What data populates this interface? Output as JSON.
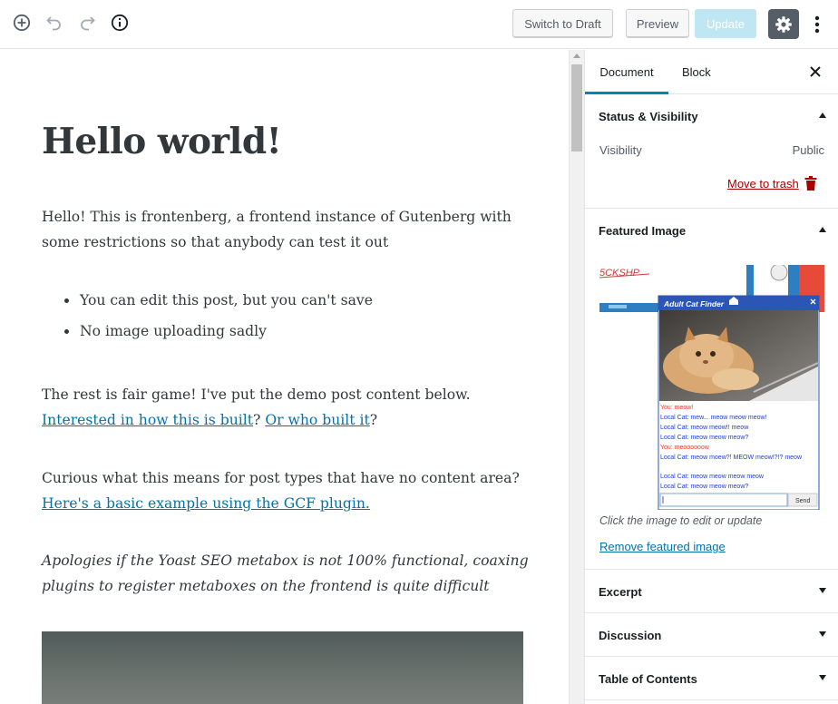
{
  "toolbar": {
    "icons": [
      "add-block-icon",
      "undo-icon",
      "redo-icon",
      "info-icon"
    ],
    "switch_to_draft_label": "Switch to Draft",
    "preview_label": "Preview",
    "update_label": "Update",
    "settings_icon": "gear-icon",
    "more_icon": "more-vertical-icon"
  },
  "post": {
    "title": "Hello world!",
    "intro": "Hello! This is frontenberg, a frontend instance of Gutenberg with some restrictions so that anybody can test it out",
    "bullets": [
      "You can edit this post, but you can't save",
      "No image uploading sadly"
    ],
    "fair_game_text": "The rest is fair game! I've put the demo post content below. ",
    "link_built": "Interested in how this is built",
    "question_sep": "? ",
    "link_who": "Or who built it",
    "question_end": "?",
    "curious_text": "Curious what this means for post types that have no content area? ",
    "link_gcf": "Here's a basic example using the GCF plugin.",
    "apology_text": "Apologies if the Yoast SEO metabox is not 100% functional, coaxing plugins to register metaboxes on the frontend is quite difficult"
  },
  "sidebar": {
    "tabs": [
      {
        "label": "Document",
        "active": true
      },
      {
        "label": "Block",
        "active": false
      }
    ],
    "status_visibility": {
      "title": "Status & Visibility",
      "visibility_label": "Visibility",
      "visibility_value": "Public",
      "trash_label": "Move to trash"
    },
    "featured_image": {
      "title": "Featured Image",
      "popup_title": "Adult Cat Finder",
      "chat": [
        {
          "who": "You:",
          "text": "meow!",
          "color": "#e83a2e"
        },
        {
          "who": "Local Cat:",
          "text": "mew... meow meow meow!",
          "color": "#1d3ed6"
        },
        {
          "who": "Local Cat:",
          "text": "meow meow!! meow",
          "color": "#1d3ed6"
        },
        {
          "who": "Local Cat:",
          "text": "meow meow meow?",
          "color": "#1d3ed6"
        },
        {
          "who": "You:",
          "text": "meoooooow",
          "color": "#e83a2e"
        },
        {
          "who": "Local Cat:",
          "text": "meow moew?! MEOW meow!?!? meow",
          "color": "#1d3ed6"
        },
        {
          "who": "Local Cat:",
          "text": "meow meow meow meow",
          "color": "#1d3ed6"
        },
        {
          "who": "Local Cat:",
          "text": "meow meow meow?",
          "color": "#1d3ed6"
        }
      ],
      "send_label": "Send",
      "caption": "Click the image to edit or update",
      "remove_label": "Remove featured image"
    },
    "panels": [
      "Excerpt",
      "Discussion",
      "Table of Contents"
    ]
  },
  "colors": {
    "accent": "#0085ba",
    "link": "#0073aa",
    "danger": "#a00",
    "update_disabled": "#bfe7f3",
    "settings_active": "#555d66"
  }
}
